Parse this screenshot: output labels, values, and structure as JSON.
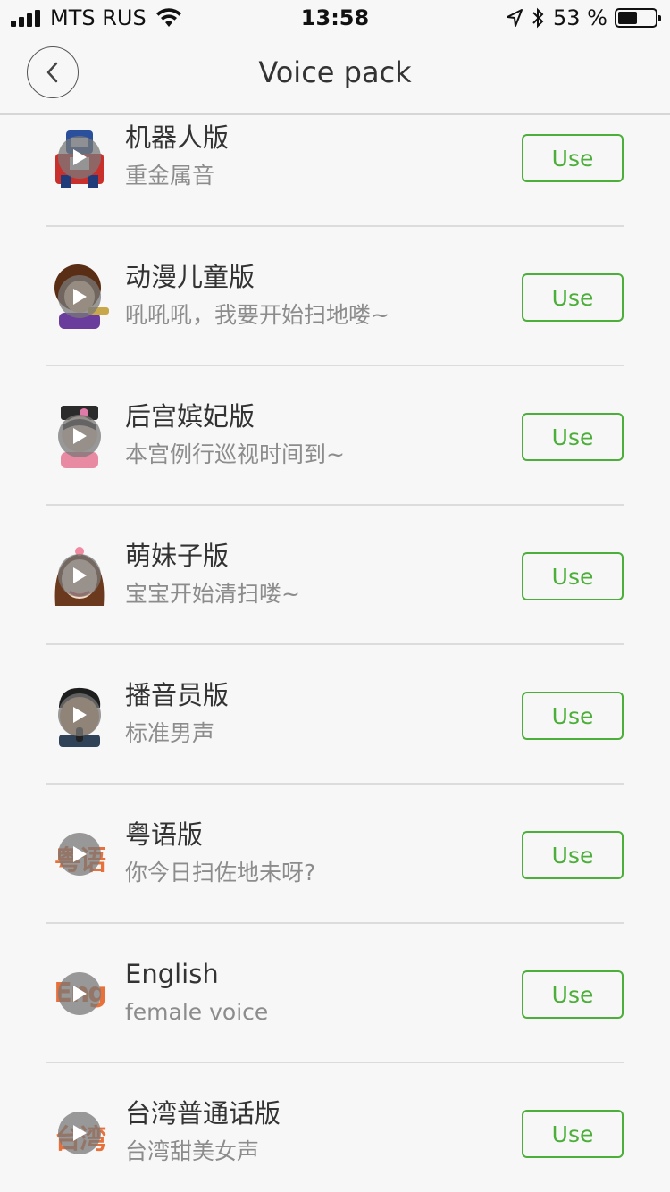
{
  "status_bar": {
    "carrier": "MTS RUS",
    "time": "13:58",
    "battery_percent": "53 %",
    "battery_level": 0.53
  },
  "header": {
    "title": "Voice pack"
  },
  "voice_packs": [
    {
      "title": "机器人版",
      "subtitle": "重金属音",
      "button": "Use",
      "thumb_icon": "robot-avatar-icon"
    },
    {
      "title": "动漫儿童版",
      "subtitle": "吼吼吼，我要开始扫地喽~",
      "button": "Use",
      "thumb_icon": "kid-avatar-icon"
    },
    {
      "title": "后宫嫔妃版",
      "subtitle": "本宫例行巡视时间到~",
      "button": "Use",
      "thumb_icon": "concubine-avatar-icon"
    },
    {
      "title": "萌妹子版",
      "subtitle": "宝宝开始清扫喽~",
      "button": "Use",
      "thumb_icon": "cute-girl-avatar-icon"
    },
    {
      "title": "播音员版",
      "subtitle": "标准男声",
      "button": "Use",
      "thumb_icon": "announcer-avatar-icon"
    },
    {
      "title": "粤语版",
      "subtitle": "你今日扫佐地未呀?",
      "button": "Use",
      "thumb_icon": "cantonese-icon",
      "thumb_text": "粤语"
    },
    {
      "title": "English",
      "subtitle": "female voice",
      "button": "Use",
      "thumb_icon": "english-icon",
      "thumb_text": "Eng"
    },
    {
      "title": "台湾普通话版",
      "subtitle": "台湾甜美女声",
      "button": "Use",
      "thumb_icon": "taiwan-icon",
      "thumb_text": "台湾"
    }
  ],
  "colors": {
    "accent": "#4caf3a",
    "thumb_text": "#e8703a"
  }
}
